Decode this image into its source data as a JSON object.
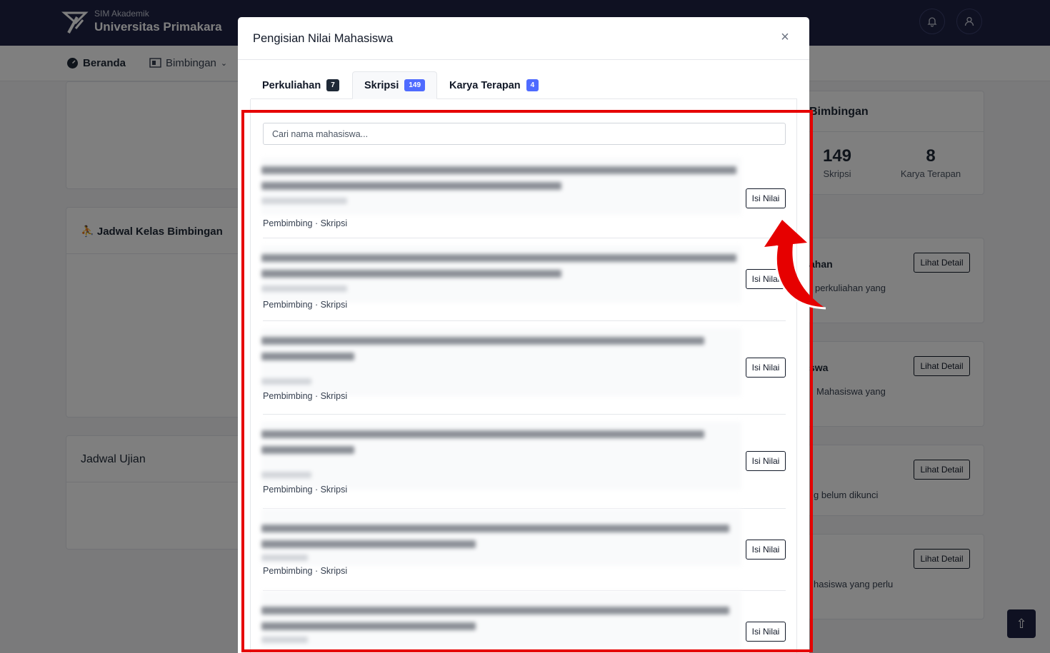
{
  "navbar": {
    "app_small": "SIM Akademik",
    "app_name": "Universitas Primakara",
    "bell_icon": "bell-icon",
    "user_icon": "user-icon"
  },
  "subnav": {
    "home": "Beranda",
    "guidance": "Bimbingan"
  },
  "background": {
    "schedule_class": "Jadwal Kelas Bimbingan",
    "schedule_exam": "Jadwal Ujian",
    "summary_title": "Bimbingan",
    "stats": [
      {
        "value": "149",
        "label": "Skripsi"
      },
      {
        "value": "8",
        "label": "Karya Terapan"
      }
    ],
    "side_cards": [
      {
        "title": "ahan",
        "text": "perkuliahan yang",
        "button": "Lihat Detail"
      },
      {
        "title": "swa",
        "text": "Mahasiswa yang",
        "button": "Lihat Detail"
      },
      {
        "title": "",
        "text": "g belum dikunci",
        "button": "Lihat Detail"
      },
      {
        "title": "",
        "text": "hasiswa yang perlu",
        "button": "Lihat Detail"
      }
    ]
  },
  "modal": {
    "title": "Pengisian Nilai Mahasiswa",
    "close_icon": "close-icon",
    "tabs": [
      {
        "label": "Perkuliahan",
        "count": "7",
        "color": "#1f2937"
      },
      {
        "label": "Skripsi",
        "count": "149",
        "color": "#4f6bff"
      },
      {
        "label": "Karya Terapan",
        "count": "4",
        "color": "#4f6bff"
      }
    ],
    "search_placeholder": "Cari nama mahasiswa...",
    "items": [
      {
        "meta": "Pembimbing · Skripsi",
        "button": "Isi Nilai"
      },
      {
        "meta": "Pembimbing · Skripsi",
        "button": "Isi Nilai"
      },
      {
        "meta": "Pembimbing · Skripsi",
        "button": "Isi Nilai"
      },
      {
        "meta": "Pembimbing · Skripsi",
        "button": "Isi Nilai"
      },
      {
        "meta": "Pembimbing · Skripsi",
        "button": "Isi Nilai"
      },
      {
        "meta": "",
        "button": "Isi Nilai"
      }
    ]
  },
  "colors": {
    "navbar": "#1e2244",
    "annotation": "#e60000",
    "badge_active": "#4f6bff"
  }
}
